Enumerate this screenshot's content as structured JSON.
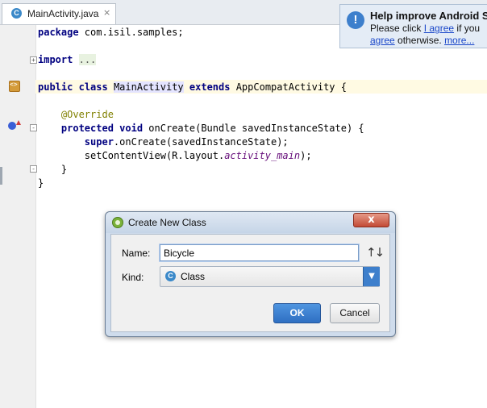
{
  "tab": {
    "label": "MainActivity.java",
    "icon": "class-icon",
    "close": "×"
  },
  "code": {
    "package_kw": "package",
    "package_name": " com.isil.samples;",
    "import_kw": "import",
    "import_dots": "...",
    "public_kw": "public",
    "class_kw": "class",
    "class_name": "MainActivity",
    "extends_kw": "extends",
    "superclass": " AppCompatActivity {",
    "annotation": "@Override",
    "protected_kw": "protected",
    "void_kw": "void",
    "method_sig": " onCreate(Bundle savedInstanceState) {",
    "super_kw": "super",
    "super_call": ".onCreate(savedInstanceState);",
    "setcontent_pre": "setContentView(R.layout.",
    "setcontent_field": "activity_main",
    "setcontent_post": ");",
    "close_method": "}",
    "close_class": "}"
  },
  "notification": {
    "title": "Help improve Android S",
    "line1_pre": "Please click ",
    "link_agree": "I agree",
    "line1_post": " if you",
    "link_agree2": "agree",
    "line2_mid": " otherwise. ",
    "link_more": "more..."
  },
  "dialog": {
    "title": "Create New Class",
    "close": "x",
    "name_label": "Name:",
    "name_value": "Bicycle",
    "sort_icon": "↑↓",
    "kind_label": "Kind:",
    "kind_icon": "C",
    "kind_value": "Class",
    "kind_arrow": "▼",
    "ok_label": "OK",
    "cancel_label": "Cancel"
  },
  "colors": {
    "accent": "#3d7fcc",
    "keyword": "#000080",
    "annotation": "#808000"
  }
}
